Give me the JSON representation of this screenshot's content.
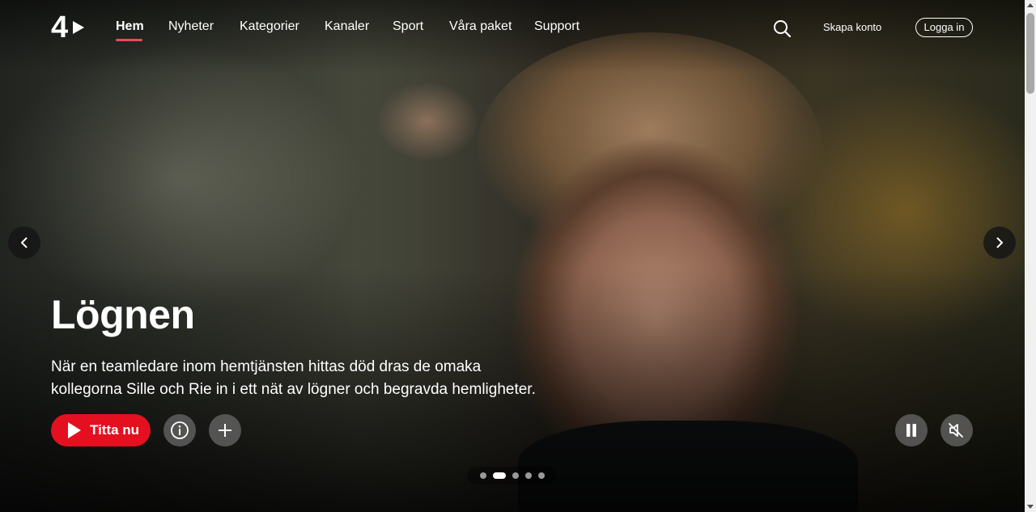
{
  "brand": {
    "logo_text": "4"
  },
  "nav": {
    "items": [
      {
        "label": "Hem",
        "active": true
      },
      {
        "label": "Nyheter",
        "active": false
      },
      {
        "label": "Kategorier",
        "active": false
      },
      {
        "label": "Kanaler",
        "active": false
      },
      {
        "label": "Sport",
        "active": false
      },
      {
        "label": "Våra paket",
        "active": false
      },
      {
        "label": "Support",
        "active": false
      }
    ],
    "search_icon": "search-icon",
    "create_account": "Skapa konto",
    "login": "Logga in"
  },
  "hero": {
    "title": "Lögnen",
    "description_line1": "När en teamledare inom hemtjänsten hittas död dras de omaka",
    "description_line2": "kollegorna Sille och Rie in i ett nät av lögner och begravda hemligheter.",
    "watch_label": "Titta nu",
    "info_icon": "info-icon",
    "add_icon": "plus-icon",
    "pause_icon": "pause-icon",
    "mute_icon": "muted-speaker-icon",
    "prev_icon": "chevron-left-icon",
    "next_icon": "chevron-right-icon"
  },
  "carousel": {
    "slide_count": 5,
    "active_index": 1
  },
  "colors": {
    "accent": "#e4101f",
    "active_underline": "#ec4a5a"
  }
}
